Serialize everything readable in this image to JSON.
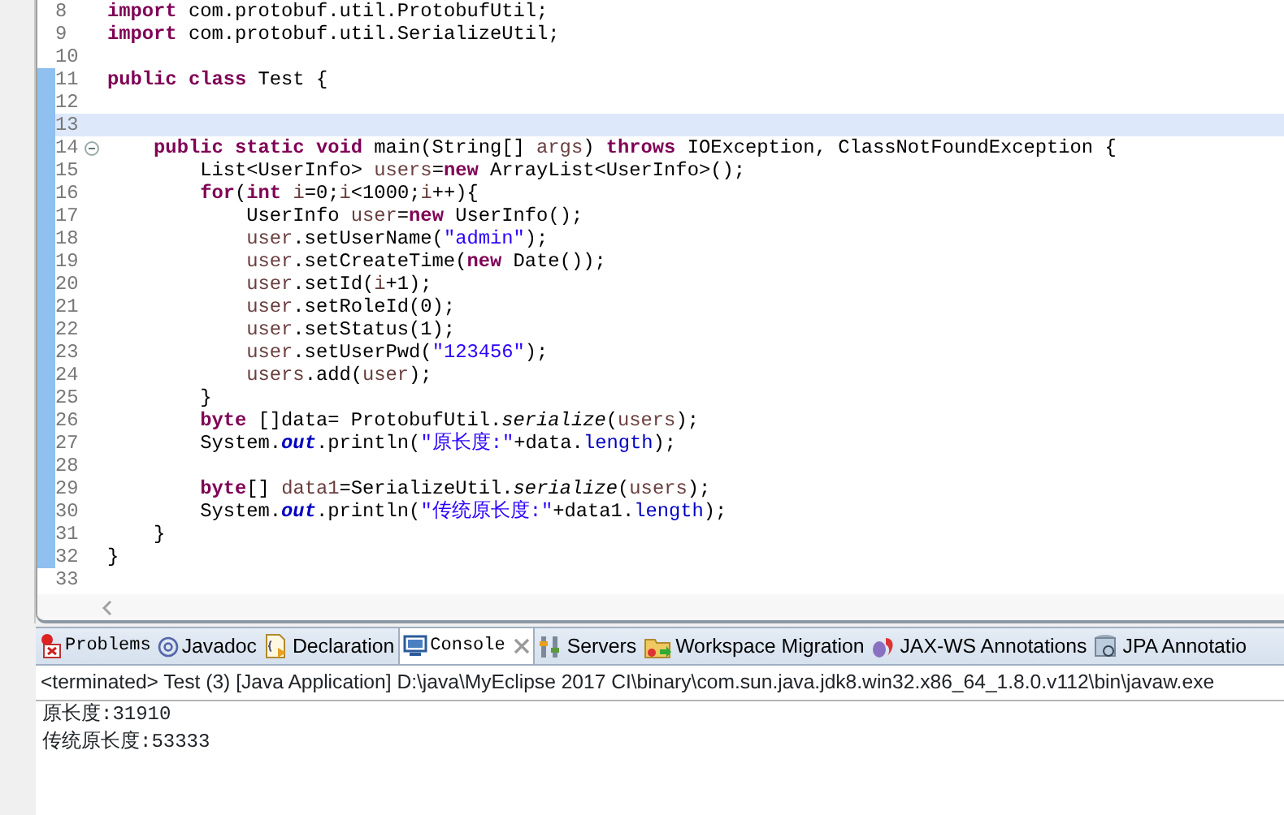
{
  "editor": {
    "lines": [
      {
        "number": "8",
        "changed": false,
        "current": false,
        "fold": false,
        "tokens": [
          {
            "kind": "kw",
            "text": "import"
          },
          {
            "kind": "plain",
            "text": " com.protobuf.util.ProtobufUtil;"
          }
        ]
      },
      {
        "number": "9",
        "changed": false,
        "current": false,
        "fold": false,
        "tokens": [
          {
            "kind": "kw",
            "text": "import"
          },
          {
            "kind": "plain",
            "text": " com.protobuf.util.SerializeUtil;"
          }
        ]
      },
      {
        "number": "10",
        "changed": false,
        "current": false,
        "fold": false
      },
      {
        "number": "11",
        "changed": true,
        "current": false,
        "fold": false,
        "tokens": [
          {
            "kind": "kw",
            "text": "public class"
          },
          {
            "kind": "plain",
            "text": " Test {"
          }
        ]
      },
      {
        "number": "12",
        "changed": true,
        "current": false,
        "fold": false
      },
      {
        "number": "13",
        "changed": true,
        "current": true,
        "fold": false
      },
      {
        "number": "14",
        "changed": true,
        "current": false,
        "fold": true,
        "tokens": [
          {
            "kind": "kw",
            "text": "    public static void"
          },
          {
            "kind": "plain",
            "text": " main(String[] "
          },
          {
            "kind": "var",
            "text": "args"
          },
          {
            "kind": "plain",
            "text": ") "
          },
          {
            "kind": "kw",
            "text": "throws"
          },
          {
            "kind": "plain",
            "text": " IOException, ClassNotFoundException {"
          }
        ]
      },
      {
        "number": "15",
        "changed": true,
        "current": false,
        "fold": false,
        "tokens": [
          {
            "kind": "plain",
            "text": "        List<UserInfo> "
          },
          {
            "kind": "var",
            "text": "users"
          },
          {
            "kind": "plain",
            "text": "="
          },
          {
            "kind": "kw",
            "text": "new"
          },
          {
            "kind": "plain",
            "text": " ArrayList<UserInfo>();"
          }
        ]
      },
      {
        "number": "16",
        "changed": true,
        "current": false,
        "fold": false,
        "tokens": [
          {
            "kind": "kw",
            "text": "        for"
          },
          {
            "kind": "plain",
            "text": "("
          },
          {
            "kind": "kw",
            "text": "int"
          },
          {
            "kind": "var",
            "text": " i"
          },
          {
            "kind": "plain",
            "text": "=0;"
          },
          {
            "kind": "var",
            "text": "i"
          },
          {
            "kind": "plain",
            "text": "<1000;"
          },
          {
            "kind": "var",
            "text": "i"
          },
          {
            "kind": "plain",
            "text": "++){"
          }
        ]
      },
      {
        "number": "17",
        "changed": true,
        "current": false,
        "fold": false,
        "tokens": [
          {
            "kind": "plain",
            "text": "            UserInfo "
          },
          {
            "kind": "var",
            "text": "user"
          },
          {
            "kind": "plain",
            "text": "="
          },
          {
            "kind": "kw",
            "text": "new"
          },
          {
            "kind": "plain",
            "text": " UserInfo();"
          }
        ]
      },
      {
        "number": "18",
        "changed": true,
        "current": false,
        "fold": false,
        "tokens": [
          {
            "kind": "var",
            "text": "            user"
          },
          {
            "kind": "plain",
            "text": ".setUserName("
          },
          {
            "kind": "str",
            "text": "\"admin\""
          },
          {
            "kind": "plain",
            "text": ");"
          }
        ]
      },
      {
        "number": "19",
        "changed": true,
        "current": false,
        "fold": false,
        "tokens": [
          {
            "kind": "var",
            "text": "            user"
          },
          {
            "kind": "plain",
            "text": ".setCreateTime("
          },
          {
            "kind": "kw",
            "text": "new"
          },
          {
            "kind": "plain",
            "text": " Date());"
          }
        ]
      },
      {
        "number": "20",
        "changed": true,
        "current": false,
        "fold": false,
        "tokens": [
          {
            "kind": "var",
            "text": "            user"
          },
          {
            "kind": "plain",
            "text": ".setId("
          },
          {
            "kind": "var",
            "text": "i"
          },
          {
            "kind": "plain",
            "text": "+1);"
          }
        ]
      },
      {
        "number": "21",
        "changed": true,
        "current": false,
        "fold": false,
        "tokens": [
          {
            "kind": "var",
            "text": "            user"
          },
          {
            "kind": "plain",
            "text": ".setRoleId(0);"
          }
        ]
      },
      {
        "number": "22",
        "changed": true,
        "current": false,
        "fold": false,
        "tokens": [
          {
            "kind": "var",
            "text": "            user"
          },
          {
            "kind": "plain",
            "text": ".setStatus(1);"
          }
        ]
      },
      {
        "number": "23",
        "changed": true,
        "current": false,
        "fold": false,
        "tokens": [
          {
            "kind": "var",
            "text": "            user"
          },
          {
            "kind": "plain",
            "text": ".setUserPwd("
          },
          {
            "kind": "str",
            "text": "\"123456\""
          },
          {
            "kind": "plain",
            "text": ");"
          }
        ]
      },
      {
        "number": "24",
        "changed": true,
        "current": false,
        "fold": false,
        "tokens": [
          {
            "kind": "var",
            "text": "            users"
          },
          {
            "kind": "plain",
            "text": ".add("
          },
          {
            "kind": "var",
            "text": "user"
          },
          {
            "kind": "plain",
            "text": ");"
          }
        ]
      },
      {
        "number": "25",
        "changed": true,
        "current": false,
        "fold": false,
        "tokens": [
          {
            "kind": "plain",
            "text": "        }"
          }
        ]
      },
      {
        "number": "26",
        "changed": true,
        "current": false,
        "fold": false,
        "tokens": [
          {
            "kind": "kw",
            "text": "        byte"
          },
          {
            "kind": "plain",
            "text": " []data= ProtobufUtil."
          },
          {
            "kind": "static",
            "text": "serialize"
          },
          {
            "kind": "plain",
            "text": "("
          },
          {
            "kind": "var",
            "text": "users"
          },
          {
            "kind": "plain",
            "text": ");"
          }
        ]
      },
      {
        "number": "27",
        "changed": true,
        "current": false,
        "fold": false,
        "tokens": [
          {
            "kind": "plain",
            "text": "        System."
          },
          {
            "kind": "field",
            "text": "out"
          },
          {
            "kind": "plain",
            "text": ".println("
          },
          {
            "kind": "str",
            "text": "\"原长度:\""
          },
          {
            "kind": "plain",
            "text": "+data."
          },
          {
            "kind": "member",
            "text": "length"
          },
          {
            "kind": "plain",
            "text": ");"
          }
        ]
      },
      {
        "number": "28",
        "changed": true,
        "current": false,
        "fold": false
      },
      {
        "number": "29",
        "changed": true,
        "current": false,
        "fold": false,
        "tokens": [
          {
            "kind": "kw",
            "text": "        byte"
          },
          {
            "kind": "plain",
            "text": "[] "
          },
          {
            "kind": "var",
            "text": "data1"
          },
          {
            "kind": "plain",
            "text": "=SerializeUtil."
          },
          {
            "kind": "static",
            "text": "serialize"
          },
          {
            "kind": "plain",
            "text": "("
          },
          {
            "kind": "var",
            "text": "users"
          },
          {
            "kind": "plain",
            "text": ");"
          }
        ]
      },
      {
        "number": "30",
        "changed": true,
        "current": false,
        "fold": false,
        "tokens": [
          {
            "kind": "plain",
            "text": "        System."
          },
          {
            "kind": "field",
            "text": "out"
          },
          {
            "kind": "plain",
            "text": ".println("
          },
          {
            "kind": "str",
            "text": "\"传统原长度:\""
          },
          {
            "kind": "plain",
            "text": "+data1."
          },
          {
            "kind": "member",
            "text": "length"
          },
          {
            "kind": "plain",
            "text": ");"
          }
        ]
      },
      {
        "number": "31",
        "changed": true,
        "current": false,
        "fold": false,
        "tokens": [
          {
            "kind": "plain",
            "text": "    }"
          }
        ]
      },
      {
        "number": "32",
        "changed": true,
        "current": false,
        "fold": false,
        "tokens": [
          {
            "kind": "plain",
            "text": "}"
          }
        ]
      },
      {
        "number": "33",
        "changed": false,
        "current": false,
        "fold": false
      }
    ]
  },
  "bottom_panel": {
    "tabs": [
      {
        "label": "Problems",
        "selected": false
      },
      {
        "label": "Javadoc",
        "selected": false
      },
      {
        "label": "Declaration",
        "selected": false
      },
      {
        "label": "Console",
        "selected": true
      },
      {
        "label": "Servers",
        "selected": false
      },
      {
        "label": "Workspace Migration",
        "selected": false
      },
      {
        "label": "JAX-WS Annotations",
        "selected": false
      },
      {
        "label": "JPA Annotatio",
        "selected": false
      }
    ],
    "console": {
      "header": "<terminated> Test (3) [Java Application] D:\\java\\MyEclipse 2017 CI\\binary\\com.sun.java.jdk8.win32.x86_64_1.8.0.v112\\bin\\javaw.exe",
      "output": [
        "原长度:31910",
        "传统原长度:53333"
      ]
    }
  }
}
